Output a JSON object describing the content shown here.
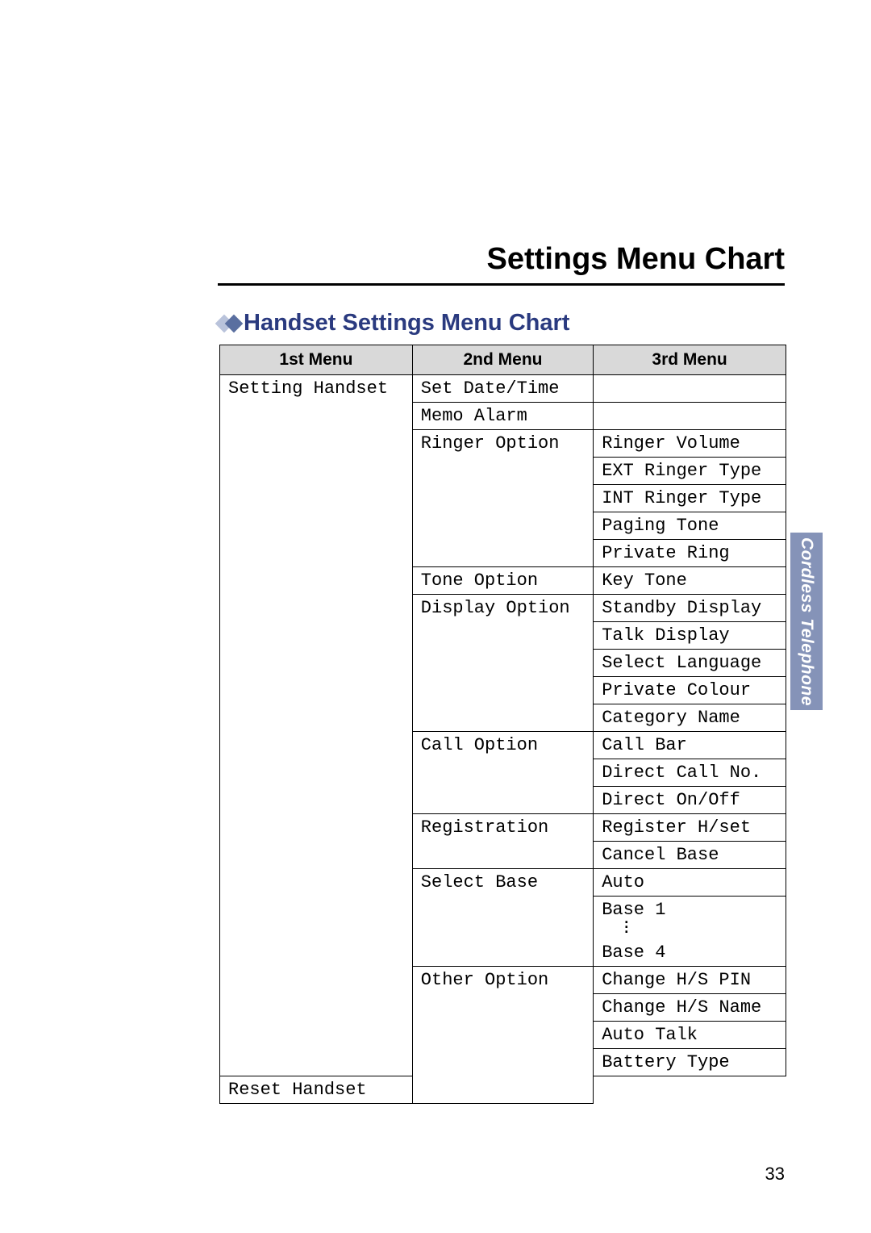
{
  "title": "Settings Menu Chart",
  "subtitle": "Handset Settings Menu Chart",
  "headers": {
    "c1": "1st Menu",
    "c2": "2nd Menu",
    "c3": "3rd Menu"
  },
  "menu1": "Setting Handset",
  "menu2": {
    "set_date": "Set Date/Time",
    "memo_alarm": "Memo Alarm",
    "ringer_option": "Ringer Option",
    "tone_option": "Tone Option",
    "display_option": "Display Option",
    "call_option": "Call Option",
    "registration": "Registration",
    "select_base": "Select Base",
    "other_option": "Other Option"
  },
  "menu3": {
    "ringer_volume": "Ringer Volume",
    "ext_ringer_type": "EXT Ringer Type",
    "int_ringer_type": "INT Ringer Type",
    "paging_tone": "Paging Tone",
    "private_ring": "Private Ring",
    "key_tone": "Key Tone",
    "standby_display": "Standby Display",
    "talk_display": "Talk Display",
    "select_language": "Select Language",
    "private_colour": "Private Colour",
    "category_name": "Category Name",
    "call_bar": "Call Bar",
    "direct_call_no": "Direct Call No.",
    "direct_on_off": "Direct On/Off",
    "register_hset": "Register H/set",
    "cancel_base": "Cancel Base",
    "auto": "Auto",
    "base1": "Base 1",
    "base4": "Base 4",
    "change_hs_pin": "Change H/S PIN",
    "change_hs_name": "Change H/S Name",
    "auto_talk": "Auto Talk",
    "battery_type": "Battery Type",
    "reset_handset": "Reset Handset"
  },
  "side_tab": "Cordless Telephone",
  "page_number": "33"
}
